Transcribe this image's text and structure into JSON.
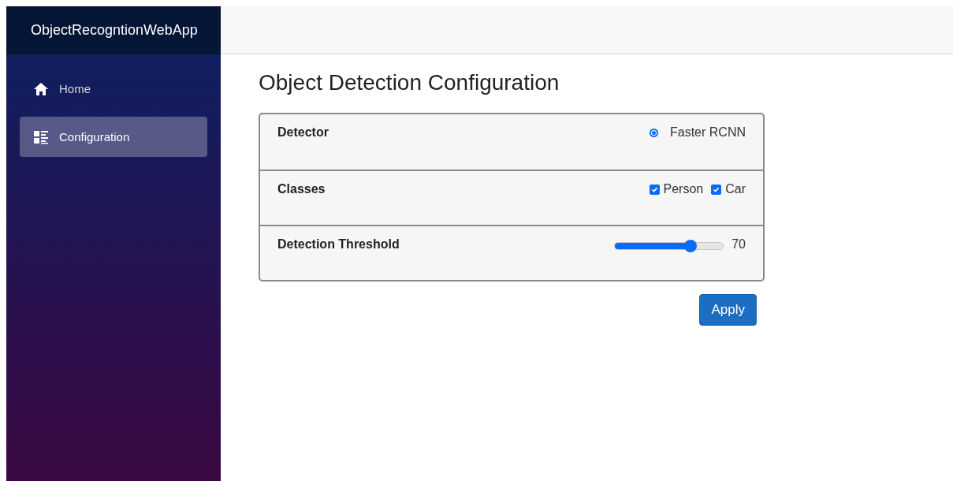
{
  "app_title": "ObjectRecogntionWebApp",
  "nav": [
    {
      "label": "Home",
      "kind": "home",
      "selected": false
    },
    {
      "label": "Configuration",
      "kind": "list",
      "selected": true
    }
  ],
  "page_title": "Object Detection Configuration",
  "settings": [
    {
      "kind": "radio",
      "label": "Detector",
      "options": [
        {
          "label": "Faster RCNN",
          "selected": true
        }
      ]
    },
    {
      "kind": "checkboxes",
      "label": "Classes",
      "options": [
        {
          "label": "Person",
          "checked": true
        },
        {
          "label": "Car",
          "checked": true
        }
      ]
    },
    {
      "kind": "slider",
      "label": "Detection Threshold",
      "level": 0.7,
      "reading": "70"
    }
  ],
  "apply_button": "Apply"
}
